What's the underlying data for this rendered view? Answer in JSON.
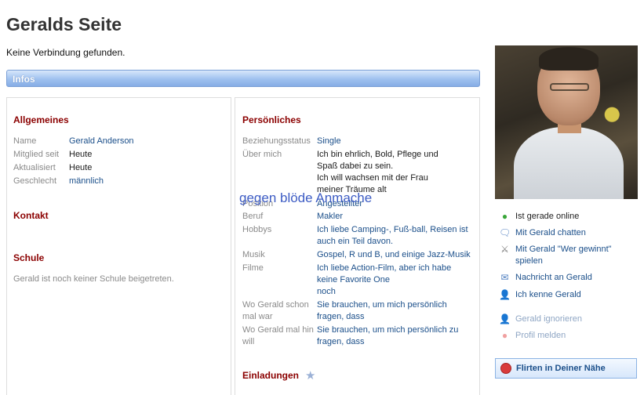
{
  "page": {
    "title": "Geralds Seite",
    "status": "Keine Verbindung gefunden.",
    "infos_bar": "Infos"
  },
  "left": {
    "allgemeines": {
      "title": "Allgemeines",
      "rows": [
        {
          "label": "Name",
          "value": "Gerald Anderson"
        },
        {
          "label": "Mitglied seit",
          "value": "Heute"
        },
        {
          "label": "Aktualisiert",
          "value": "Heute"
        },
        {
          "label": "Geschlecht",
          "value": "männlich"
        }
      ]
    },
    "kontakt": {
      "title": "Kontakt"
    },
    "schule": {
      "title": "Schule",
      "text": "Gerald ist noch keiner Schule beigetreten."
    }
  },
  "right": {
    "persoenliches": {
      "title": "Persönliches",
      "beziehung": {
        "label": "Beziehungsstatus",
        "value": "Single"
      },
      "ueber": {
        "label": "Über mich",
        "lines": [
          "Ich bin ehrlich, Bold, Pflege und",
          "Spaß dabei zu sein.",
          "Ich will wachsen mit der Frau",
          "meiner Träume alt"
        ]
      },
      "position": {
        "label": "Position",
        "value": "Angestellter"
      },
      "beruf": {
        "label": "Beruf",
        "value": "Makler"
      },
      "hobbys": {
        "label": "Hobbys",
        "lines": [
          "Ich liebe Camping-, Fuß-ball, Reisen ist",
          "auch ein Teil davon."
        ]
      },
      "musik": {
        "label": "Musik",
        "value": "Gospel, R und B, und einige Jazz-Musik"
      },
      "filme": {
        "label": "Filme",
        "lines": [
          "Ich liebe Action-Film, aber ich habe",
          "keine Favorite One",
          "noch"
        ]
      },
      "wo_war": {
        "label_lines": [
          "Wo Gerald schon",
          "mal war"
        ],
        "lines": [
          "Sie brauchen, um mich persönlich",
          "fragen, dass"
        ]
      },
      "wo_hin": {
        "label_lines": [
          "Wo Gerald mal hin",
          "will"
        ],
        "lines": [
          "Sie brauchen, um mich persönlich zu",
          "fragen, dass"
        ]
      }
    },
    "overlay": "gegen blöde Anmache",
    "einladungen": {
      "title": "Einladungen"
    }
  },
  "sidebar": {
    "actions": [
      {
        "label": "Ist gerade online",
        "icon": "online-icon"
      },
      {
        "label": "Mit Gerald chatten",
        "icon": "chat-bubble-icon"
      },
      {
        "label_lines": [
          "Mit Gerald \"Wer gewinnt\"",
          "spielen"
        ],
        "icon": "game-icon"
      },
      {
        "label": "Nachricht an Gerald",
        "icon": "message-icon"
      },
      {
        "label": "Ich kenne Gerald",
        "icon": "user-add-icon"
      },
      {
        "label": "Gerald ignorieren",
        "icon": "user-ignore-icon"
      },
      {
        "label": "Profil melden",
        "icon": "report-icon"
      }
    ],
    "flirt_button": "Flirten in Deiner Nähe"
  }
}
